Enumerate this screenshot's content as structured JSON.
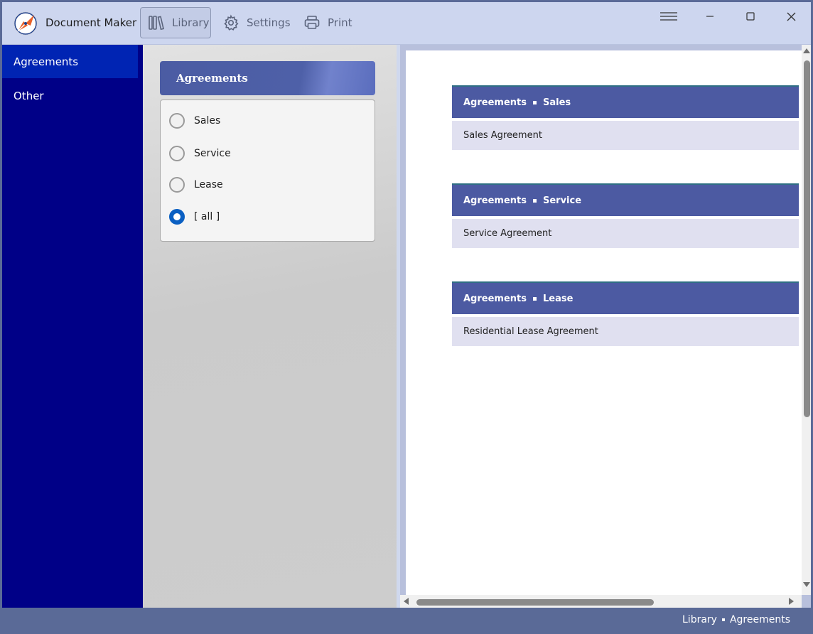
{
  "app": {
    "title": "Document Maker",
    "logo_icon": "pen-nib-logo-icon",
    "accent": "#e8622a"
  },
  "toolbar": {
    "library_label": "Library",
    "settings_label": "Settings",
    "print_label": "Print"
  },
  "window_controls": [
    "menu-icon",
    "minimize-icon",
    "maximize-icon",
    "close-icon"
  ],
  "sidebar": {
    "items": [
      {
        "label": "Agreements",
        "selected": true
      },
      {
        "label": "Other",
        "selected": false
      }
    ]
  },
  "filter": {
    "header": "Agreements",
    "options": [
      {
        "label": "Sales",
        "checked": false
      },
      {
        "label": "Service",
        "checked": false
      },
      {
        "label": "Lease",
        "checked": false
      },
      {
        "label": "[ all ]",
        "checked": true
      }
    ]
  },
  "document": {
    "sections": [
      {
        "category": "Agreements",
        "subcategory": "Sales",
        "items": [
          "Sales Agreement"
        ]
      },
      {
        "category": "Agreements",
        "subcategory": "Service",
        "items": [
          "Service Agreement"
        ]
      },
      {
        "category": "Agreements",
        "subcategory": "Lease",
        "items": [
          "Residential Lease Agreement"
        ]
      }
    ]
  },
  "statusbar": {
    "breadcrumb": [
      "Library",
      "Agreements"
    ]
  },
  "colors": {
    "sidebar_bg": "#000087",
    "sidebar_selected": "#0024b3",
    "section_header": "#4c5aa2",
    "section_row": "#e0e0f0",
    "radio_checked": "#0a5fc2",
    "statusbar_bg": "#5a6a97"
  }
}
